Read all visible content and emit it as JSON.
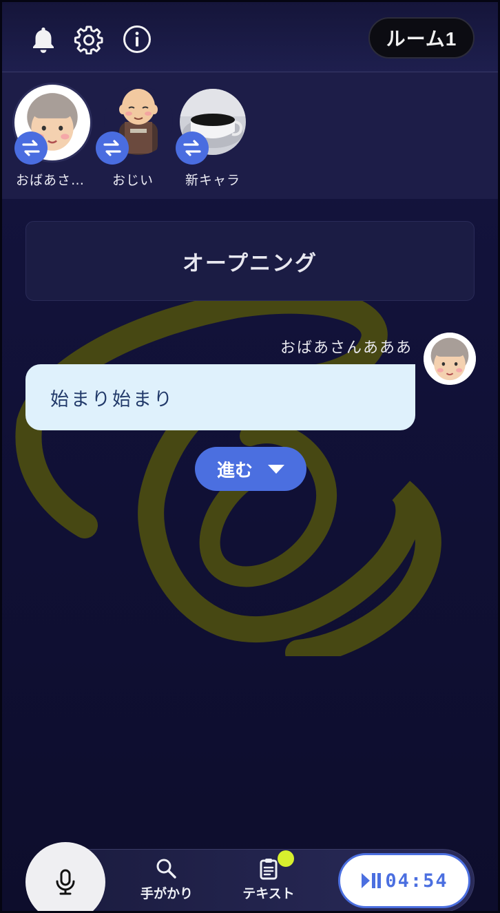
{
  "header": {
    "icons": [
      "bell-icon",
      "gear-icon",
      "info-icon"
    ],
    "room_label": "ルーム1"
  },
  "characters": [
    {
      "name": "おばあさ…",
      "avatar": "grandma-avatar",
      "selected": true
    },
    {
      "name": "おじい",
      "avatar": "grandpa-avatar",
      "selected": false
    },
    {
      "name": "新キャラ",
      "avatar": "coffee-cup-avatar",
      "selected": false
    }
  ],
  "scene": {
    "title": "オープニング"
  },
  "message": {
    "speaker": "おばあさんあああ",
    "text": "始まり始まり"
  },
  "next_button": {
    "label": "進む"
  },
  "bottom": {
    "clue_label": "手がかり",
    "text_label": "テキスト",
    "timer": "04:54"
  },
  "colors": {
    "accent": "#4b6fe0",
    "background": "#12123a",
    "bubble": "#dff1fc",
    "notification": "#d7ef2e",
    "watermark": "#4e4f10"
  }
}
